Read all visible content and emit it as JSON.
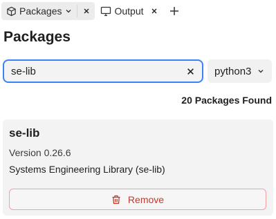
{
  "tabs": [
    {
      "label": "Packages",
      "icon": "package-icon",
      "active": true
    },
    {
      "label": "Output",
      "icon": "monitor-icon",
      "active": false
    }
  ],
  "page": {
    "title": "Packages"
  },
  "search": {
    "value": "se-lib",
    "placeholder": ""
  },
  "environment_select": {
    "selected": "python3"
  },
  "results": {
    "count_text": "20 Packages Found"
  },
  "package_card": {
    "name": "se-lib",
    "version": "Version 0.26.6",
    "description": "Systems Engineering Library (se-lib)",
    "remove_label": "Remove"
  },
  "colors": {
    "focus_border": "#3b82f6",
    "danger": "#c0392b",
    "danger_border": "#f2a0a0",
    "card_bg": "#f3f3f3"
  }
}
